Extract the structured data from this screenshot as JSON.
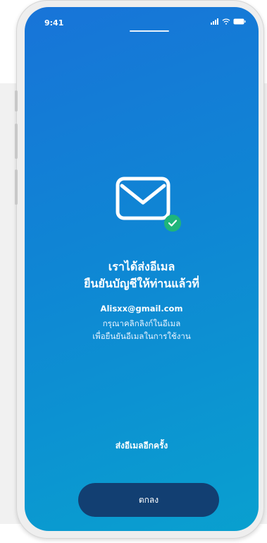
{
  "status_bar": {
    "time": "9:41",
    "icons": [
      "signal-icon",
      "wifi-icon",
      "battery-icon"
    ]
  },
  "confirmation": {
    "icon": "mail-check-icon",
    "title_line1": "เราได้ส่งอีเมล",
    "title_line2": "ยืนยันบัญชีให้ท่านแล้วที่",
    "email": "Alisxx@gmail.com",
    "desc_line1": "กรุณาคลิกลิงก์ในอีเมล",
    "desc_line2": "เพื่อยืนยันอีเมลในการใช้งาน"
  },
  "actions": {
    "resend_label": "ส่งอีเมลอีกครั้ง",
    "ok_label": "ตกลง"
  },
  "colors": {
    "gradient_start": "#1874d8",
    "gradient_end": "#09a0cf",
    "button_bg": "#123f72",
    "badge_green": "#1fb57a"
  }
}
